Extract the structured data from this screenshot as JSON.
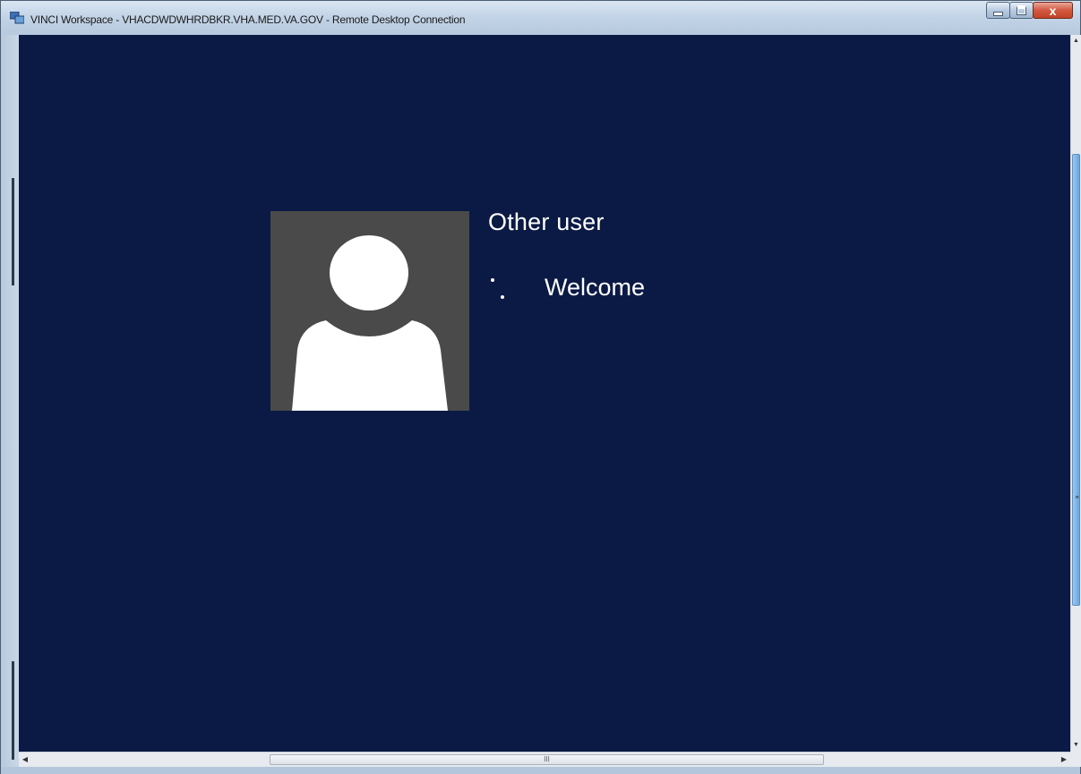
{
  "window": {
    "title": "VINCI Workspace - VHACDWDWHRDBKR.VHA.MED.VA.GOV - Remote Desktop Connection",
    "app_icon": "remote-desktop-icon",
    "buttons": {
      "minimize": "minimize-icon",
      "maximize": "maximize-icon",
      "close": "close-icon"
    },
    "close_glyph": "x"
  },
  "lock_screen": {
    "user_name": "Other user",
    "status_text": "Welcome",
    "avatar_icon": "user-silhouette-icon",
    "background_color": "#0b1a45",
    "avatar_background": "#4a4a4a"
  },
  "scrollbars": {
    "horizontal_grip": "III",
    "vertical_grip": "≡"
  }
}
